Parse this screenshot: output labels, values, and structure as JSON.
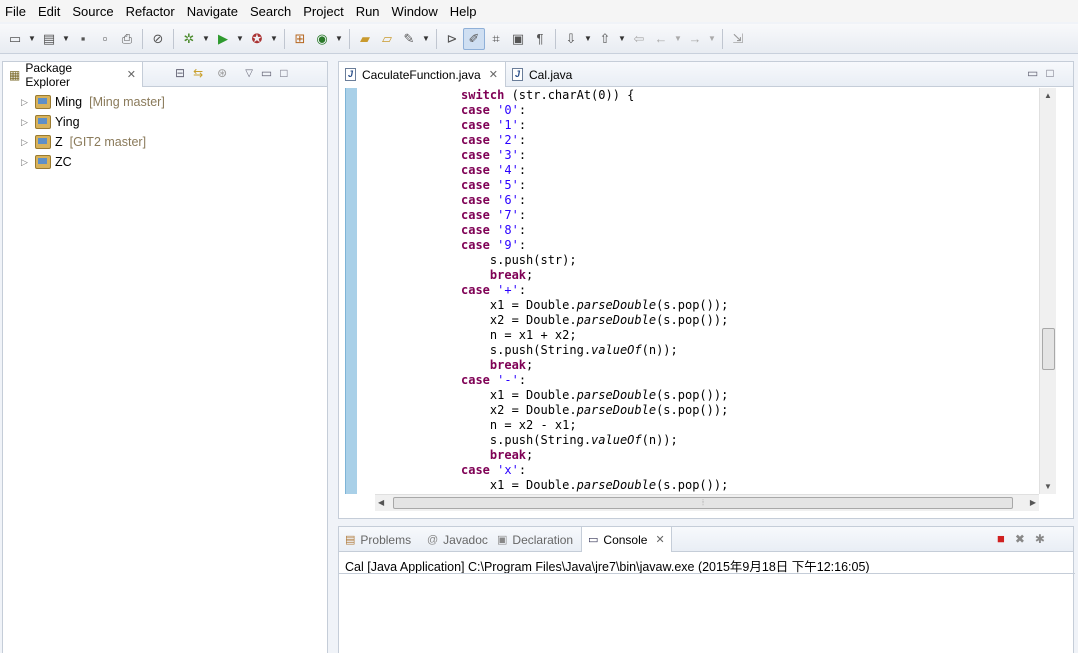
{
  "menu": [
    "File",
    "Edit",
    "Source",
    "Refactor",
    "Navigate",
    "Search",
    "Project",
    "Run",
    "Window",
    "Help"
  ],
  "explorer": {
    "tab_label": "Package Explorer",
    "projects": [
      {
        "name": "Ming",
        "git": "[Ming master]"
      },
      {
        "name": "Ying",
        "git": ""
      },
      {
        "name": "Z",
        "git": "[GIT2 master]"
      },
      {
        "name": "ZC",
        "git": ""
      }
    ]
  },
  "editor": {
    "tabs": [
      {
        "label": "CaculateFunction.java",
        "active": true
      },
      {
        "label": "Cal.java",
        "active": false
      }
    ],
    "code_lines": [
      [
        [
          "kw",
          "switch"
        ],
        [
          "t",
          " (str.charAt(0)) {"
        ]
      ],
      [
        [
          "kw",
          "case"
        ],
        [
          "t",
          " "
        ],
        [
          "str",
          "'0'"
        ],
        [
          "t",
          ":"
        ]
      ],
      [
        [
          "kw",
          "case"
        ],
        [
          "t",
          " "
        ],
        [
          "str",
          "'1'"
        ],
        [
          "t",
          ":"
        ]
      ],
      [
        [
          "kw",
          "case"
        ],
        [
          "t",
          " "
        ],
        [
          "str",
          "'2'"
        ],
        [
          "t",
          ":"
        ]
      ],
      [
        [
          "kw",
          "case"
        ],
        [
          "t",
          " "
        ],
        [
          "str",
          "'3'"
        ],
        [
          "t",
          ":"
        ]
      ],
      [
        [
          "kw",
          "case"
        ],
        [
          "t",
          " "
        ],
        [
          "str",
          "'4'"
        ],
        [
          "t",
          ":"
        ]
      ],
      [
        [
          "kw",
          "case"
        ],
        [
          "t",
          " "
        ],
        [
          "str",
          "'5'"
        ],
        [
          "t",
          ":"
        ]
      ],
      [
        [
          "kw",
          "case"
        ],
        [
          "t",
          " "
        ],
        [
          "str",
          "'6'"
        ],
        [
          "t",
          ":"
        ]
      ],
      [
        [
          "kw",
          "case"
        ],
        [
          "t",
          " "
        ],
        [
          "str",
          "'7'"
        ],
        [
          "t",
          ":"
        ]
      ],
      [
        [
          "kw",
          "case"
        ],
        [
          "t",
          " "
        ],
        [
          "str",
          "'8'"
        ],
        [
          "t",
          ":"
        ]
      ],
      [
        [
          "kw",
          "case"
        ],
        [
          "t",
          " "
        ],
        [
          "str",
          "'9'"
        ],
        [
          "t",
          ":"
        ]
      ],
      [
        [
          "t",
          "    s.push(str);"
        ]
      ],
      [
        [
          "t",
          "    "
        ],
        [
          "kw",
          "break"
        ],
        [
          "t",
          ";"
        ]
      ],
      [
        [
          "kw",
          "case"
        ],
        [
          "t",
          " "
        ],
        [
          "str",
          "'+'"
        ],
        [
          "t",
          ":"
        ]
      ],
      [
        [
          "t",
          "    x1 = Double."
        ],
        [
          "it",
          "parseDouble"
        ],
        [
          "t",
          "(s.pop());"
        ]
      ],
      [
        [
          "t",
          "    x2 = Double."
        ],
        [
          "it",
          "parseDouble"
        ],
        [
          "t",
          "(s.pop());"
        ]
      ],
      [
        [
          "t",
          "    n = x1 + x2;"
        ]
      ],
      [
        [
          "t",
          "    s.push(String."
        ],
        [
          "it",
          "valueOf"
        ],
        [
          "t",
          "(n));"
        ]
      ],
      [
        [
          "t",
          "    "
        ],
        [
          "kw",
          "break"
        ],
        [
          "t",
          ";"
        ]
      ],
      [
        [
          "kw",
          "case"
        ],
        [
          "t",
          " "
        ],
        [
          "str",
          "'-'"
        ],
        [
          "t",
          ":"
        ]
      ],
      [
        [
          "t",
          "    x1 = Double."
        ],
        [
          "it",
          "parseDouble"
        ],
        [
          "t",
          "(s.pop());"
        ]
      ],
      [
        [
          "t",
          "    x2 = Double."
        ],
        [
          "it",
          "parseDouble"
        ],
        [
          "t",
          "(s.pop());"
        ]
      ],
      [
        [
          "t",
          "    n = x2 - x1;"
        ]
      ],
      [
        [
          "t",
          "    s.push(String."
        ],
        [
          "it",
          "valueOf"
        ],
        [
          "t",
          "(n));"
        ]
      ],
      [
        [
          "t",
          "    "
        ],
        [
          "kw",
          "break"
        ],
        [
          "t",
          ";"
        ]
      ],
      [
        [
          "kw",
          "case"
        ],
        [
          "t",
          " "
        ],
        [
          "str",
          "'x'"
        ],
        [
          "t",
          ":"
        ]
      ],
      [
        [
          "t",
          "    x1 = Double."
        ],
        [
          "it",
          "parseDouble"
        ],
        [
          "t",
          "(s.pop());"
        ]
      ]
    ]
  },
  "console": {
    "tabs": [
      "Problems",
      "Javadoc",
      "Declaration",
      "Console"
    ],
    "active_tab": "Console",
    "description": "Cal [Java Application] C:\\Program Files\\Java\\jre7\\bin\\javaw.exe (2015年9月18日 下午12:16:05)"
  },
  "colors": {
    "keyword": "#7f0055",
    "string": "#2a00ff",
    "ruler": "#a9d0e8"
  }
}
